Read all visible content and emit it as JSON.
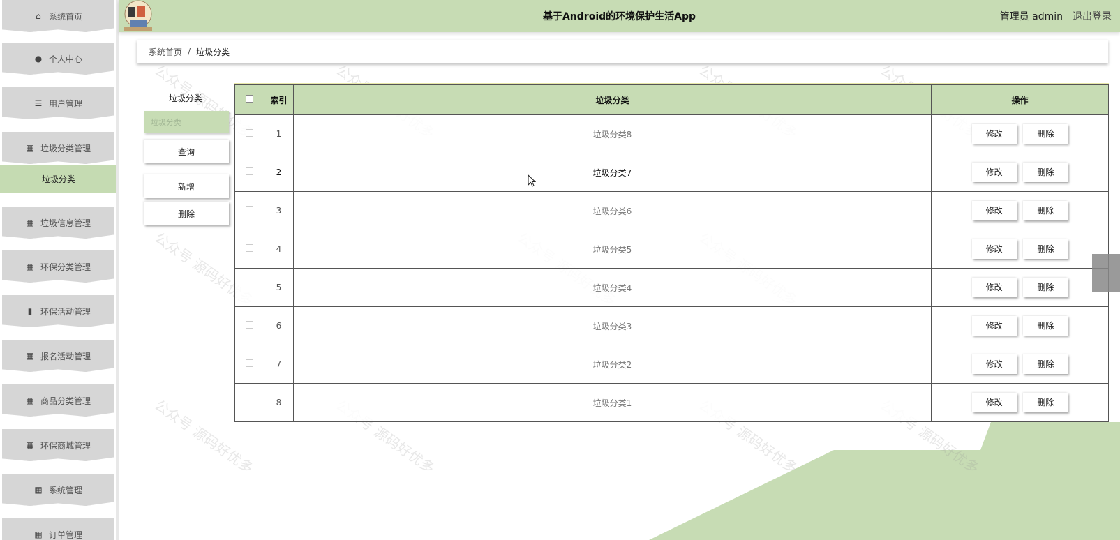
{
  "header": {
    "title": "基于Android的环境保护生活App",
    "user": "管理员 admin",
    "logout": "退出登录"
  },
  "sidebar": {
    "items": [
      {
        "label": "系统首页",
        "icon": "home-icon"
      },
      {
        "label": "个人中心",
        "icon": "user-icon"
      },
      {
        "label": "用户管理",
        "icon": "list-icon"
      },
      {
        "label": "垃圾分类管理",
        "icon": "grid-icon"
      },
      {
        "label": "垃圾信息管理",
        "icon": "grid-icon"
      },
      {
        "label": "环保分类管理",
        "icon": "grid-icon"
      },
      {
        "label": "环保活动管理",
        "icon": "book-icon"
      },
      {
        "label": "报名活动管理",
        "icon": "grid-icon"
      },
      {
        "label": "商品分类管理",
        "icon": "grid-icon"
      },
      {
        "label": "环保商城管理",
        "icon": "grid-icon"
      },
      {
        "label": "系统管理",
        "icon": "grid-icon"
      },
      {
        "label": "订单管理",
        "icon": "grid-icon"
      }
    ],
    "active_sub": "垃圾分类"
  },
  "breadcrumb": {
    "home": "系统首页",
    "separator": "/",
    "current": "垃圾分类"
  },
  "search": {
    "label": "垃圾分类",
    "placeholder": "垃圾分类",
    "query_button": "查询",
    "add_button": "新增",
    "delete_button": "删除"
  },
  "table": {
    "columns": [
      "索引",
      "垃圾分类",
      "操作"
    ],
    "rows": [
      {
        "index": "1",
        "name": "垃圾分类8"
      },
      {
        "index": "2",
        "name": "垃圾分类7"
      },
      {
        "index": "3",
        "name": "垃圾分类6"
      },
      {
        "index": "4",
        "name": "垃圾分类5"
      },
      {
        "index": "5",
        "name": "垃圾分类4"
      },
      {
        "index": "6",
        "name": "垃圾分类3"
      },
      {
        "index": "7",
        "name": "垃圾分类2"
      },
      {
        "index": "8",
        "name": "垃圾分类1"
      }
    ],
    "edit_label": "修改",
    "delete_label": "删除"
  },
  "watermark": "公众号 源码好优多",
  "colors": {
    "accent_green": "#c7dcb4",
    "sidebar_gray": "#d6d6d6",
    "active_green": "#c5dbb2"
  }
}
